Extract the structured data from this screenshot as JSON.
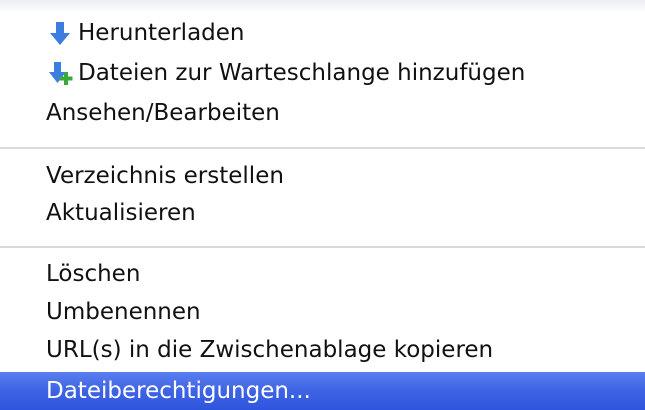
{
  "menu": {
    "items": [
      {
        "label": "Herunterladen",
        "icon": "download-arrow-icon"
      },
      {
        "label": "Dateien zur Warteschlange hinzufügen",
        "icon": "add-to-queue-icon"
      },
      {
        "label": "Ansehen/Bearbeiten"
      },
      {
        "label": "Verzeichnis erstellen"
      },
      {
        "label": "Aktualisieren"
      },
      {
        "label": "Löschen"
      },
      {
        "label": "Umbenennen"
      },
      {
        "label": "URL(s) in die Zwischenablage kopieren"
      },
      {
        "label": "Dateiberechtigungen...",
        "selected": true
      }
    ]
  },
  "colors": {
    "selection": "#3a60e2",
    "arrow": "#3b7de0",
    "plus": "#3aa83a",
    "separator": "#d9d9d9"
  }
}
